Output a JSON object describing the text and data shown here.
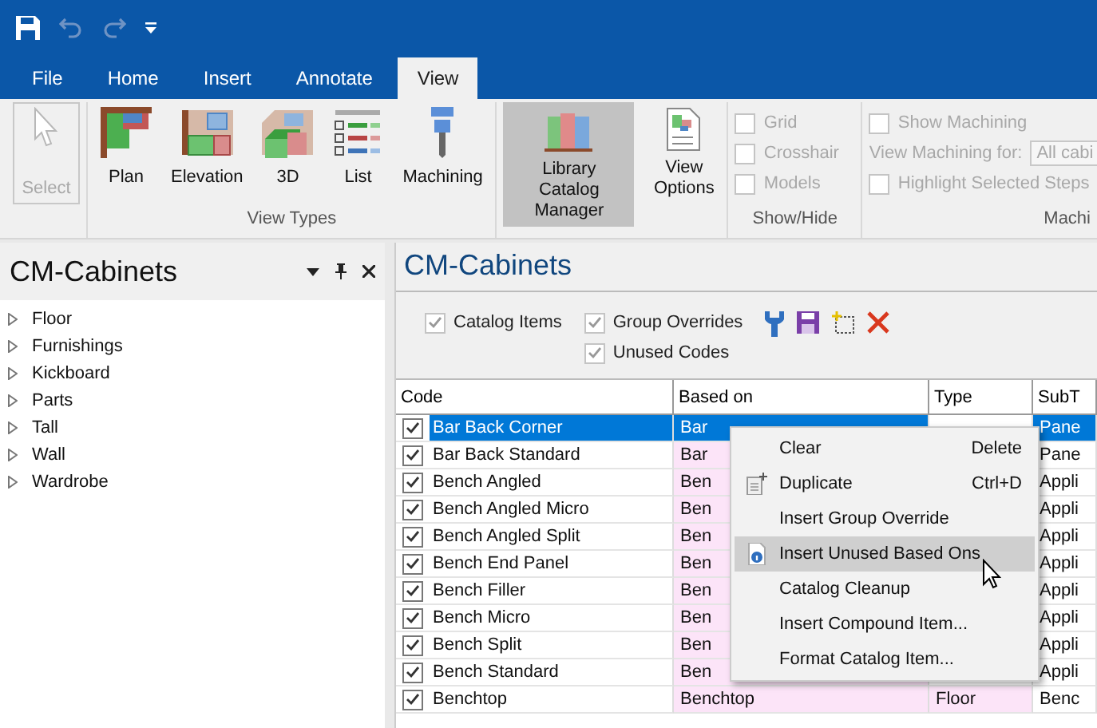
{
  "quick_access": {
    "items": [
      {
        "kind": "save",
        "disabled": false
      },
      {
        "kind": "undo",
        "disabled": true
      },
      {
        "kind": "redo",
        "disabled": true
      },
      {
        "kind": "customize",
        "disabled": false
      }
    ]
  },
  "tabs": [
    {
      "label": "File",
      "selected": false
    },
    {
      "label": "Home",
      "selected": false
    },
    {
      "label": "Insert",
      "selected": false
    },
    {
      "label": "Annotate",
      "selected": false
    },
    {
      "label": "View",
      "selected": true
    }
  ],
  "ribbon": {
    "select": {
      "label": "Select",
      "disabled": true
    },
    "view_types": {
      "label": "View Types",
      "buttons": [
        {
          "kind": "plan",
          "label": "Plan"
        },
        {
          "kind": "elevation",
          "label": "Elevation"
        },
        {
          "kind": "perspective",
          "label": "3D"
        },
        {
          "kind": "list",
          "label": "List"
        },
        {
          "kind": "machining",
          "label": "Machining"
        }
      ]
    },
    "library": {
      "label": "Library Catalog Manager",
      "selected": true
    },
    "view_options": {
      "label": "View Options"
    },
    "show_hide": {
      "label": "Show/Hide",
      "items": [
        {
          "label": "Grid",
          "checked": false,
          "disabled": true
        },
        {
          "label": "Crosshair",
          "checked": false,
          "disabled": true
        },
        {
          "label": "Models",
          "checked": false,
          "disabled": true
        }
      ]
    },
    "machining": {
      "label": "Machi",
      "show": {
        "label": "Show Machining",
        "checked": false
      },
      "for_label": "View Machining for:",
      "for_value": "All cabi",
      "highlight": {
        "label": "Highlight Selected Steps",
        "checked": false
      }
    }
  },
  "sidebar": {
    "title": "CM-Cabinets",
    "items": [
      {
        "label": "Floor",
        "expanded": false
      },
      {
        "label": "Furnishings",
        "expanded": false
      },
      {
        "label": "Kickboard",
        "expanded": false
      },
      {
        "label": "Parts",
        "expanded": false
      },
      {
        "label": "Tall",
        "expanded": false
      },
      {
        "label": "Wall",
        "expanded": false
      },
      {
        "label": "Wardrobe",
        "expanded": false
      }
    ]
  },
  "catalog": {
    "title": "CM-Cabinets",
    "filters": [
      {
        "label": "Catalog Items",
        "checked": true
      },
      {
        "label": "Group Overrides",
        "checked": true
      },
      {
        "label": "Unused Codes",
        "checked": true
      }
    ],
    "table": {
      "columns": [
        "Code",
        "Based on",
        "Type",
        "SubT"
      ],
      "rows": [
        {
          "checked": true,
          "selected": true,
          "cells": [
            "Bar Back Corner",
            "Bar",
            "",
            "Pane"
          ]
        },
        {
          "checked": true,
          "selected": false,
          "cells": [
            "Bar Back Standard",
            "Bar",
            "",
            "Pane"
          ]
        },
        {
          "checked": true,
          "selected": false,
          "cells": [
            "Bench Angled",
            "Ben",
            "",
            "Appli"
          ]
        },
        {
          "checked": true,
          "selected": false,
          "cells": [
            "Bench Angled Micro",
            "Ben",
            "",
            "Appli"
          ]
        },
        {
          "checked": true,
          "selected": false,
          "cells": [
            "Bench Angled Split",
            "Ben",
            "",
            "Appli"
          ]
        },
        {
          "checked": true,
          "selected": false,
          "cells": [
            "Bench End Panel",
            "Ben",
            "",
            "Appli"
          ]
        },
        {
          "checked": true,
          "selected": false,
          "cells": [
            "Bench Filler",
            "Ben",
            "",
            "Appli"
          ]
        },
        {
          "checked": true,
          "selected": false,
          "cells": [
            "Bench Micro",
            "Ben",
            "",
            "Appli"
          ]
        },
        {
          "checked": true,
          "selected": false,
          "cells": [
            "Bench Split",
            "Ben",
            "",
            "Appli"
          ]
        },
        {
          "checked": true,
          "selected": false,
          "cells": [
            "Bench Standard",
            "Ben",
            "",
            "Appli"
          ]
        },
        {
          "checked": true,
          "selected": false,
          "cells": [
            "Benchtop",
            "Benchtop",
            "Floor",
            "Benc"
          ]
        }
      ]
    }
  },
  "context_menu": {
    "items": [
      {
        "label": "Clear",
        "shortcut": "Delete",
        "kind": "plain",
        "selected": false
      },
      {
        "label": "Duplicate",
        "shortcut": "Ctrl+D",
        "kind": "duplicate",
        "selected": false
      },
      {
        "label": "Insert Group Override",
        "kind": "plain",
        "selected": false
      },
      {
        "label": "Insert Unused Based Ons",
        "kind": "info",
        "selected": true
      },
      {
        "label": "Catalog Cleanup",
        "kind": "plain",
        "selected": false
      },
      {
        "label": "Insert Compound Item...",
        "kind": "plain",
        "selected": false
      },
      {
        "label": "Format Catalog Item...",
        "kind": "plain",
        "selected": false
      }
    ]
  }
}
